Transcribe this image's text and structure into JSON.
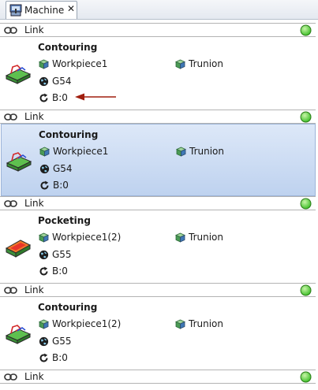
{
  "tab": {
    "label": "Machine",
    "icon": "machine-icon",
    "close_glyph": "✕"
  },
  "link_label": "Link",
  "status_color": "#3fbf2a",
  "operations": [
    {
      "title": "Contouring",
      "workpiece": "Workpiece1",
      "fixture": "Trunion",
      "wcs": "G54",
      "rotation": "B:0",
      "icon": "contour-toolpath-icon",
      "selected": false,
      "annotated": true
    },
    {
      "title": "Contouring",
      "workpiece": "Workpiece1",
      "fixture": "Trunion",
      "wcs": "G54",
      "rotation": "B:0",
      "icon": "contour-toolpath-icon",
      "selected": true,
      "annotated": false
    },
    {
      "title": "Pocketing",
      "workpiece": "Workpiece1(2)",
      "fixture": "Trunion",
      "wcs": "G55",
      "rotation": "B:0",
      "icon": "pocket-toolpath-icon",
      "selected": false,
      "annotated": false
    },
    {
      "title": "Contouring",
      "workpiece": "Workpiece1(2)",
      "fixture": "Trunion",
      "wcs": "G55",
      "rotation": "B:0",
      "icon": "contour-toolpath-icon",
      "selected": false,
      "annotated": false
    }
  ],
  "annotation_color": "#a01e0e"
}
